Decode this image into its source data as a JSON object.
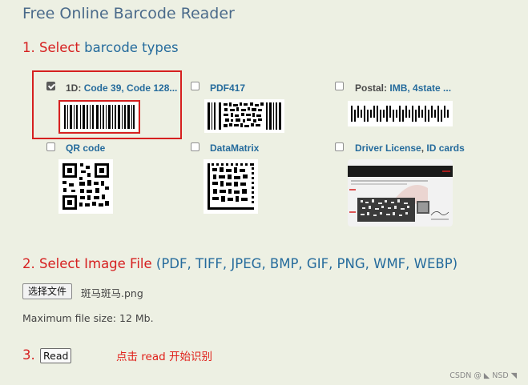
{
  "header": {
    "title": "Free Online Barcode Reader"
  },
  "step1": {
    "number": "1. Select",
    "text": "barcode types"
  },
  "barcode_types": [
    {
      "label_prefix": "1D:",
      "label_rest": "Code 39, Code 128...",
      "checked": true,
      "highlighted": true
    },
    {
      "label": "PDF417",
      "checked": false
    },
    {
      "label_prefix": "Postal:",
      "label_rest": "IMB, 4state ...",
      "checked": false
    },
    {
      "label": "QR code",
      "checked": false
    },
    {
      "label": "DataMatrix",
      "checked": false
    },
    {
      "label_a": "Driver License",
      "label_b": "ID cards",
      "checked": false
    }
  ],
  "step2": {
    "label": "2. Select Image File",
    "formats": "(PDF, TIFF, JPEG, BMP, GIF, PNG, WMF, WEBP)"
  },
  "file_input": {
    "button_label": "选择文件",
    "selected_file": "斑马斑马.png"
  },
  "max_size": "Maximum file size: 12 Mb.",
  "step3": {
    "number": "3.",
    "button_label": "Read",
    "annotation": "点击 read 开始识别"
  },
  "watermark": "CSDN @ ◣ NSD ◥",
  "colors": {
    "accent_red": "#d62020",
    "link_blue": "#256b9c",
    "background": "#edf0e3"
  }
}
